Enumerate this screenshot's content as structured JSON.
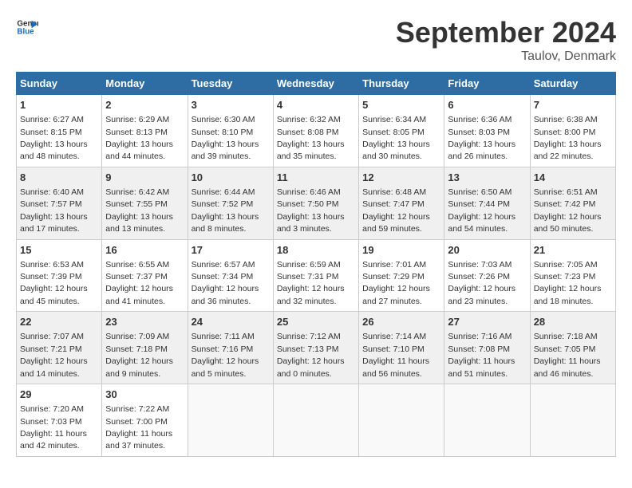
{
  "header": {
    "logo_general": "General",
    "logo_blue": "Blue",
    "month_title": "September 2024",
    "location": "Taulov, Denmark"
  },
  "columns": [
    "Sunday",
    "Monday",
    "Tuesday",
    "Wednesday",
    "Thursday",
    "Friday",
    "Saturday"
  ],
  "weeks": [
    [
      {
        "day": "1",
        "sunrise": "Sunrise: 6:27 AM",
        "sunset": "Sunset: 8:15 PM",
        "daylight": "Daylight: 13 hours and 48 minutes."
      },
      {
        "day": "2",
        "sunrise": "Sunrise: 6:29 AM",
        "sunset": "Sunset: 8:13 PM",
        "daylight": "Daylight: 13 hours and 44 minutes."
      },
      {
        "day": "3",
        "sunrise": "Sunrise: 6:30 AM",
        "sunset": "Sunset: 8:10 PM",
        "daylight": "Daylight: 13 hours and 39 minutes."
      },
      {
        "day": "4",
        "sunrise": "Sunrise: 6:32 AM",
        "sunset": "Sunset: 8:08 PM",
        "daylight": "Daylight: 13 hours and 35 minutes."
      },
      {
        "day": "5",
        "sunrise": "Sunrise: 6:34 AM",
        "sunset": "Sunset: 8:05 PM",
        "daylight": "Daylight: 13 hours and 30 minutes."
      },
      {
        "day": "6",
        "sunrise": "Sunrise: 6:36 AM",
        "sunset": "Sunset: 8:03 PM",
        "daylight": "Daylight: 13 hours and 26 minutes."
      },
      {
        "day": "7",
        "sunrise": "Sunrise: 6:38 AM",
        "sunset": "Sunset: 8:00 PM",
        "daylight": "Daylight: 13 hours and 22 minutes."
      }
    ],
    [
      {
        "day": "8",
        "sunrise": "Sunrise: 6:40 AM",
        "sunset": "Sunset: 7:57 PM",
        "daylight": "Daylight: 13 hours and 17 minutes."
      },
      {
        "day": "9",
        "sunrise": "Sunrise: 6:42 AM",
        "sunset": "Sunset: 7:55 PM",
        "daylight": "Daylight: 13 hours and 13 minutes."
      },
      {
        "day": "10",
        "sunrise": "Sunrise: 6:44 AM",
        "sunset": "Sunset: 7:52 PM",
        "daylight": "Daylight: 13 hours and 8 minutes."
      },
      {
        "day": "11",
        "sunrise": "Sunrise: 6:46 AM",
        "sunset": "Sunset: 7:50 PM",
        "daylight": "Daylight: 13 hours and 3 minutes."
      },
      {
        "day": "12",
        "sunrise": "Sunrise: 6:48 AM",
        "sunset": "Sunset: 7:47 PM",
        "daylight": "Daylight: 12 hours and 59 minutes."
      },
      {
        "day": "13",
        "sunrise": "Sunrise: 6:50 AM",
        "sunset": "Sunset: 7:44 PM",
        "daylight": "Daylight: 12 hours and 54 minutes."
      },
      {
        "day": "14",
        "sunrise": "Sunrise: 6:51 AM",
        "sunset": "Sunset: 7:42 PM",
        "daylight": "Daylight: 12 hours and 50 minutes."
      }
    ],
    [
      {
        "day": "15",
        "sunrise": "Sunrise: 6:53 AM",
        "sunset": "Sunset: 7:39 PM",
        "daylight": "Daylight: 12 hours and 45 minutes."
      },
      {
        "day": "16",
        "sunrise": "Sunrise: 6:55 AM",
        "sunset": "Sunset: 7:37 PM",
        "daylight": "Daylight: 12 hours and 41 minutes."
      },
      {
        "day": "17",
        "sunrise": "Sunrise: 6:57 AM",
        "sunset": "Sunset: 7:34 PM",
        "daylight": "Daylight: 12 hours and 36 minutes."
      },
      {
        "day": "18",
        "sunrise": "Sunrise: 6:59 AM",
        "sunset": "Sunset: 7:31 PM",
        "daylight": "Daylight: 12 hours and 32 minutes."
      },
      {
        "day": "19",
        "sunrise": "Sunrise: 7:01 AM",
        "sunset": "Sunset: 7:29 PM",
        "daylight": "Daylight: 12 hours and 27 minutes."
      },
      {
        "day": "20",
        "sunrise": "Sunrise: 7:03 AM",
        "sunset": "Sunset: 7:26 PM",
        "daylight": "Daylight: 12 hours and 23 minutes."
      },
      {
        "day": "21",
        "sunrise": "Sunrise: 7:05 AM",
        "sunset": "Sunset: 7:23 PM",
        "daylight": "Daylight: 12 hours and 18 minutes."
      }
    ],
    [
      {
        "day": "22",
        "sunrise": "Sunrise: 7:07 AM",
        "sunset": "Sunset: 7:21 PM",
        "daylight": "Daylight: 12 hours and 14 minutes."
      },
      {
        "day": "23",
        "sunrise": "Sunrise: 7:09 AM",
        "sunset": "Sunset: 7:18 PM",
        "daylight": "Daylight: 12 hours and 9 minutes."
      },
      {
        "day": "24",
        "sunrise": "Sunrise: 7:11 AM",
        "sunset": "Sunset: 7:16 PM",
        "daylight": "Daylight: 12 hours and 5 minutes."
      },
      {
        "day": "25",
        "sunrise": "Sunrise: 7:12 AM",
        "sunset": "Sunset: 7:13 PM",
        "daylight": "Daylight: 12 hours and 0 minutes."
      },
      {
        "day": "26",
        "sunrise": "Sunrise: 7:14 AM",
        "sunset": "Sunset: 7:10 PM",
        "daylight": "Daylight: 11 hours and 56 minutes."
      },
      {
        "day": "27",
        "sunrise": "Sunrise: 7:16 AM",
        "sunset": "Sunset: 7:08 PM",
        "daylight": "Daylight: 11 hours and 51 minutes."
      },
      {
        "day": "28",
        "sunrise": "Sunrise: 7:18 AM",
        "sunset": "Sunset: 7:05 PM",
        "daylight": "Daylight: 11 hours and 46 minutes."
      }
    ],
    [
      {
        "day": "29",
        "sunrise": "Sunrise: 7:20 AM",
        "sunset": "Sunset: 7:03 PM",
        "daylight": "Daylight: 11 hours and 42 minutes."
      },
      {
        "day": "30",
        "sunrise": "Sunrise: 7:22 AM",
        "sunset": "Sunset: 7:00 PM",
        "daylight": "Daylight: 11 hours and 37 minutes."
      },
      null,
      null,
      null,
      null,
      null
    ]
  ]
}
